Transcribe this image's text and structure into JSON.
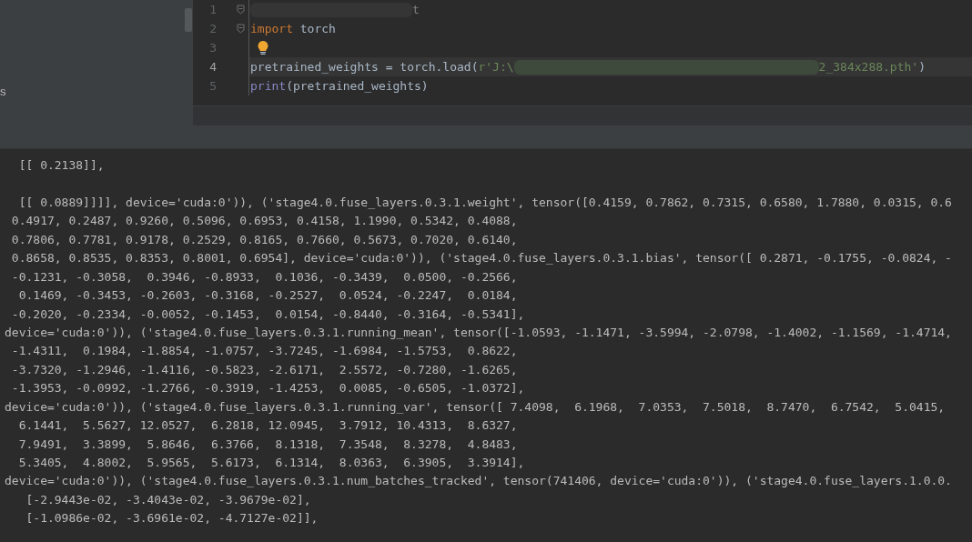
{
  "sidebar": {
    "items": [
      {
        "label": "s"
      }
    ]
  },
  "editor": {
    "lines": [
      {
        "number": "1",
        "current": false,
        "fold": true,
        "bulb": false,
        "tokens": [
          {
            "kind": "redacted"
          },
          {
            "kind": "comment",
            "text": "t"
          }
        ]
      },
      {
        "number": "2",
        "current": false,
        "fold": true,
        "bulb": false,
        "tokens": [
          {
            "kind": "keyword",
            "text": "import"
          },
          {
            "kind": "plain",
            "text": " torch"
          }
        ]
      },
      {
        "number": "3",
        "current": false,
        "fold": false,
        "bulb": true
      },
      {
        "number": "4",
        "current": true,
        "fold": false,
        "bulb": false,
        "tokens": [
          {
            "kind": "plain",
            "text": "pretrained_weights = torch.load("
          },
          {
            "kind": "string",
            "text": "r'J:\\"
          },
          {
            "kind": "redacted"
          },
          {
            "kind": "string",
            "text": "2_384x288.pth'"
          },
          {
            "kind": "plain",
            "text": ")"
          }
        ]
      },
      {
        "number": "5",
        "current": false,
        "fold": false,
        "bulb": false,
        "tokens": [
          {
            "kind": "builtin",
            "text": "print"
          },
          {
            "kind": "plain",
            "text": "(pretrained_weights)"
          }
        ]
      }
    ]
  },
  "console": {
    "blank_after_first": true,
    "lines": [
      "  [[ 0.2138]],",
      "  [[ 0.0889]]]], device='cuda:0')), ('stage4.0.fuse_layers.0.3.1.weight', tensor([0.4159, 0.7862, 0.7315, 0.6580, 1.7880, 0.0315, 0.6",
      " 0.4917, 0.2487, 0.9260, 0.5096, 0.6953, 0.4158, 1.1990, 0.5342, 0.4088,",
      " 0.7806, 0.7781, 0.9178, 0.2529, 0.8165, 0.7660, 0.5673, 0.7020, 0.6140,",
      " 0.8658, 0.8535, 0.8353, 0.8001, 0.6954], device='cuda:0')), ('stage4.0.fuse_layers.0.3.1.bias', tensor([ 0.2871, -0.1755, -0.0824, -",
      " -0.1231, -0.3058,  0.3946, -0.8933,  0.1036, -0.3439,  0.0500, -0.2566,",
      "  0.1469, -0.3453, -0.2603, -0.3168, -0.2527,  0.0524, -0.2247,  0.0184,",
      " -0.2020, -0.2334, -0.0052, -0.1453,  0.0154, -0.8440, -0.3164, -0.5341],",
      "device='cuda:0')), ('stage4.0.fuse_layers.0.3.1.running_mean', tensor([-1.0593, -1.1471, -3.5994, -2.0798, -1.4002, -1.1569, -1.4714,",
      " -1.4311,  0.1984, -1.8854, -1.0757, -3.7245, -1.6984, -1.5753,  0.8622,",
      " -3.7320, -1.2946, -1.4116, -0.5823, -2.6171,  2.5572, -0.7280, -1.6265,",
      " -1.3953, -0.0992, -1.2766, -0.3919, -1.4253,  0.0085, -0.6505, -1.0372],",
      "device='cuda:0')), ('stage4.0.fuse_layers.0.3.1.running_var', tensor([ 7.4098,  6.1968,  7.0353,  7.5018,  8.7470,  6.7542,  5.0415,",
      "  6.1441,  5.5627, 12.0527,  6.2818, 12.0945,  3.7912, 10.4313,  8.6327,",
      "  7.9491,  3.3899,  5.8646,  6.3766,  8.1318,  7.3548,  8.3278,  4.8483,",
      "  5.3405,  4.8002,  5.9565,  5.6173,  6.1314,  8.0363,  6.3905,  3.3914],",
      "device='cuda:0')), ('stage4.0.fuse_layers.0.3.1.num_batches_tracked', tensor(741406, device='cuda:0')), ('stage4.0.fuse_layers.1.0.0.",
      "   [-2.9443e-02, -3.4043e-02, -3.9679e-02],",
      "   [-1.0986e-02, -3.6961e-02, -4.7127e-02]],"
    ]
  }
}
